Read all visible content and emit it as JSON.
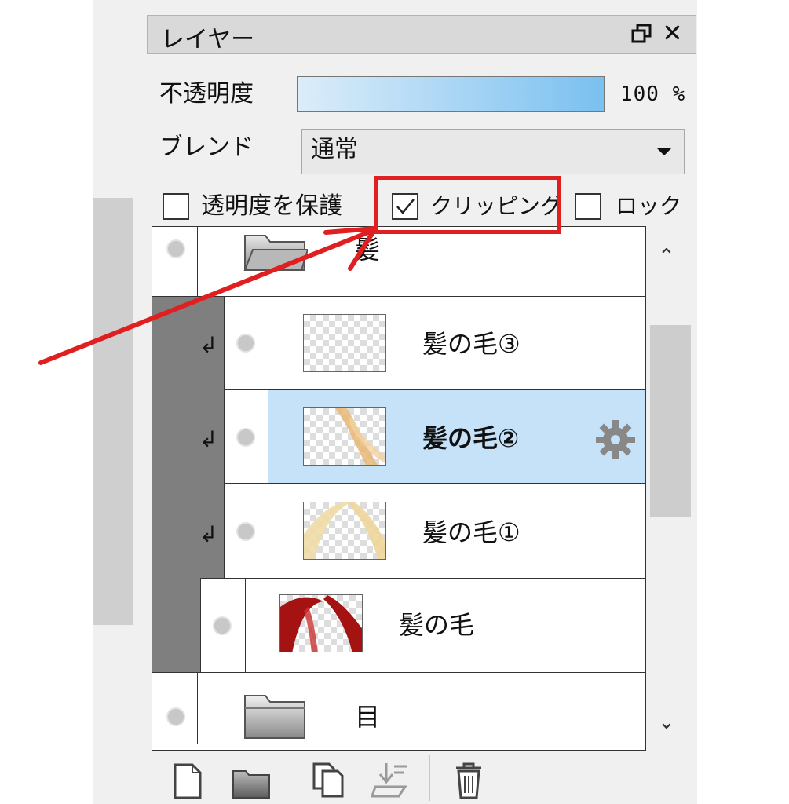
{
  "panel": {
    "title": "レイヤー"
  },
  "controls": {
    "opacity_label": "不透明度",
    "opacity_value": "100 %",
    "opacity_percent": 100,
    "blend_label": "ブレンド",
    "blend_value": "通常",
    "protect_label": "透明度を保護",
    "protect_checked": false,
    "clipping_label": "クリッピング",
    "clipping_checked": true,
    "lock_label": "ロック",
    "lock_checked": false
  },
  "layers": [
    {
      "name": "髪",
      "type": "folder"
    },
    {
      "name": "髪の毛③",
      "clipped": true
    },
    {
      "name": "髪の毛②",
      "clipped": true,
      "selected": true
    },
    {
      "name": "髪の毛①",
      "clipped": true
    },
    {
      "name": "髪の毛"
    },
    {
      "name": "目",
      "type": "folder"
    }
  ],
  "colors": {
    "annotation_red": "#e02020",
    "selected_row": "#c5e2f8",
    "clip_bar": "#7f7f7f"
  }
}
